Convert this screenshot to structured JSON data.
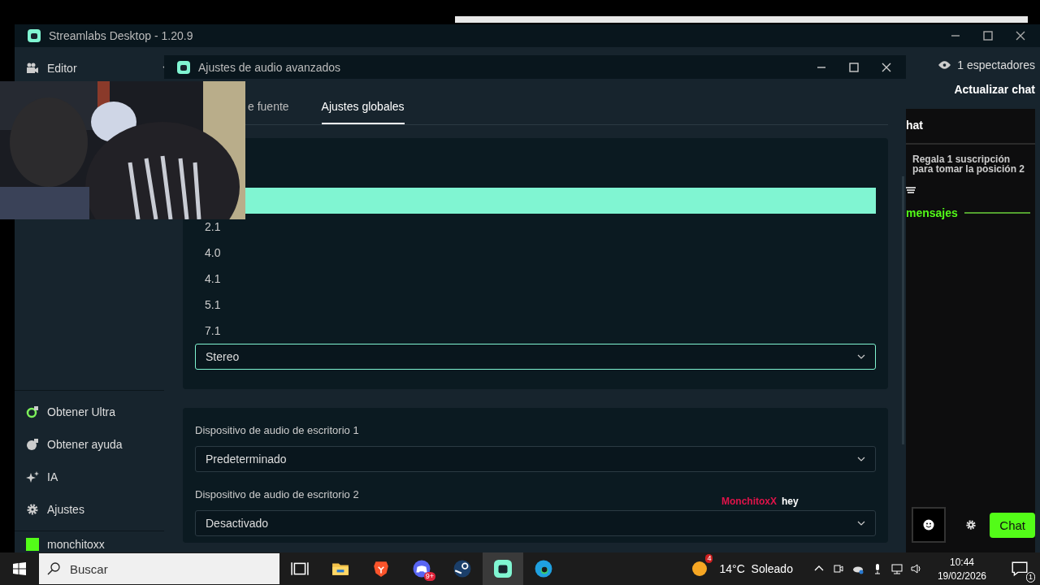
{
  "app_window": {
    "title": "Streamlabs Desktop - 1.20.9",
    "sidebar": {
      "top_item": "Editor",
      "items": [
        {
          "label": "Obtener Ultra",
          "kind": "ultra"
        },
        {
          "label": "Obtener ayuda",
          "kind": "help"
        },
        {
          "label": "IA",
          "kind": "ai"
        },
        {
          "label": "Ajustes",
          "kind": "settings"
        }
      ],
      "user": "monchitoxx"
    },
    "chat_panel": {
      "viewers": "1 espectadores",
      "refresh": "Actualizar chat",
      "header": "hat",
      "promo": "Regala 1 suscripción para tomar la posición 2",
      "divider_label": "mensajes",
      "send_button": "Chat"
    }
  },
  "dialog": {
    "title": "Ajustes de audio avanzados",
    "tabs": [
      {
        "label": "e fuente",
        "selected": false
      },
      {
        "label": "Ajustes globales",
        "selected": true
      }
    ],
    "channels_select": {
      "value": "Stereo",
      "expanded": true,
      "options": [
        {
          "selected": true
        },
        {
          "label": "2.1",
          "selected": false
        },
        {
          "label": "4.0",
          "selected": false
        },
        {
          "label": "4.1",
          "selected": false
        },
        {
          "label": "5.1",
          "selected": false
        },
        {
          "label": "7.1",
          "selected": false
        }
      ]
    },
    "devices": [
      {
        "label": "Dispositivo de audio de escritorio 1",
        "value": "Predeterminado"
      },
      {
        "label": "Dispositivo de audio de escritorio 2",
        "value": "Desactivado"
      }
    ]
  },
  "chat_overlay": {
    "user": "MonchitoxX",
    "message": "hey"
  },
  "taskbar": {
    "search_placeholder": "Buscar",
    "discord_badge": "9+",
    "weather_badge": "4",
    "weather": "14°C  Soleado",
    "time": "10:44",
    "date": "19/02/2026",
    "notifications": "1"
  }
}
